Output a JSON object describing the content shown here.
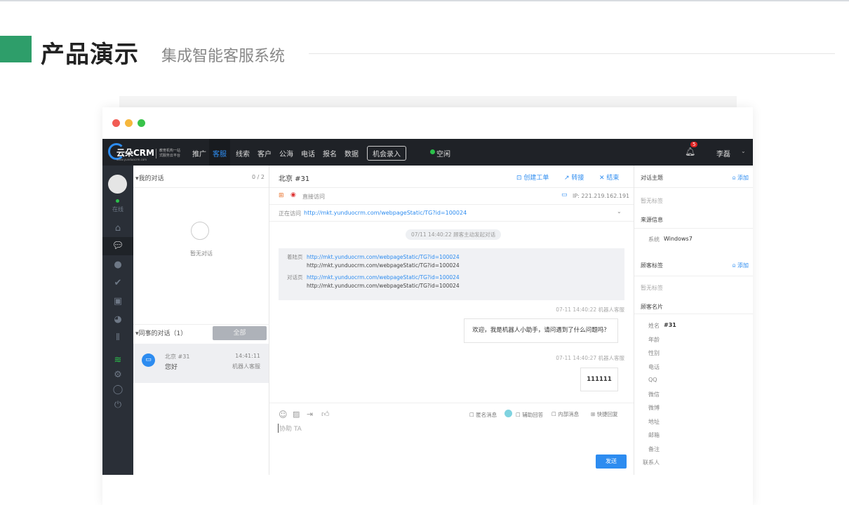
{
  "header": {
    "title": "产品演示",
    "subtitle": "集成智能客服系统"
  },
  "nav": {
    "logo": "云朵CRM",
    "logo_tag1": "教育机构一站",
    "logo_tag2": "式服务云平台",
    "logo_url": "www.yunduocrm.com",
    "items": [
      "推广",
      "客服",
      "线索",
      "客户",
      "公海",
      "电话",
      "报名",
      "数据"
    ],
    "active": "客服",
    "opportunity_button": "机会录入",
    "status": "空闲",
    "notifications": "5",
    "user": "李磊",
    "accent": "#2d8cf0"
  },
  "sidebar": {
    "status": "在线",
    "icons": [
      "home-icon",
      "chat-icon",
      "user-icon",
      "check-icon",
      "schedule-icon",
      "pie-chart-icon",
      "team-icon",
      "wifi-icon",
      "settings-icon",
      "message-icon",
      "power-icon"
    ]
  },
  "left_panel": {
    "my_title": "我的对话",
    "my_count": "0 / 2",
    "empty": "暂无对话",
    "colleague_title": "同事的对话（1）",
    "all_button": "全部",
    "items": [
      {
        "name": "北京 #31",
        "message": "您好",
        "time": "14:41:11",
        "agent": "机器人客服"
      }
    ]
  },
  "chat": {
    "title": "北京 #31",
    "create_ticket": "创建工单",
    "transfer": "转接",
    "end": "结束",
    "source": "直接访问",
    "ip": "IP:  221.219.162.191",
    "visiting_label": "正在访问",
    "visiting_url": "http://mkt.yunduocrm.com/webpageStatic/TG?id=100024",
    "system_notice": "07/11 14:40:22   顾客主动发起对话",
    "landing_label": "着陆页",
    "landing_link": "http://mkt.yunduocrm.com/webpageStatic/TG?id=100024",
    "landing_url": "http://mkt.yunduocrm.com/webpageStatic/TG?id=100024",
    "dialog_label": "对话页",
    "dialog_link": "http://mkt.yunduocrm.com/webpageStatic/TG?id=100024",
    "dialog_url": "http://mkt.yunduocrm.com/webpageStatic/TG?id=100024",
    "messages": [
      {
        "meta": "07-11 14:40:22   机器人客服",
        "text": "欢迎，我是机器人小助手，请问遇到了什么问题吗？"
      },
      {
        "meta": "07-11 14:40:27   机器人客服",
        "text": "111111"
      }
    ],
    "options": {
      "anonymous": "匿名消息",
      "assist": "辅助回答",
      "internal": "内部消息",
      "quick_reply": "快捷回复"
    },
    "input_placeholder": "协助 TA",
    "send": "发送"
  },
  "right_panel": {
    "topic_title": "对话主题",
    "add": "添加",
    "no_tag": "暂无标签",
    "source_title": "来源信息",
    "system_label": "系统",
    "system_value": "Windows7",
    "tags_title": "顾客标签",
    "card_title": "顾客名片",
    "fields": [
      {
        "label": "姓名",
        "value": "#31"
      },
      {
        "label": "年龄",
        "value": ""
      },
      {
        "label": "性别",
        "value": ""
      },
      {
        "label": "电话",
        "value": ""
      },
      {
        "label": "QQ",
        "value": ""
      },
      {
        "label": "微信",
        "value": ""
      },
      {
        "label": "微博",
        "value": ""
      },
      {
        "label": "地址",
        "value": ""
      },
      {
        "label": "邮箱",
        "value": ""
      },
      {
        "label": "备注",
        "value": ""
      },
      {
        "label": "联系人",
        "value": ""
      }
    ]
  }
}
